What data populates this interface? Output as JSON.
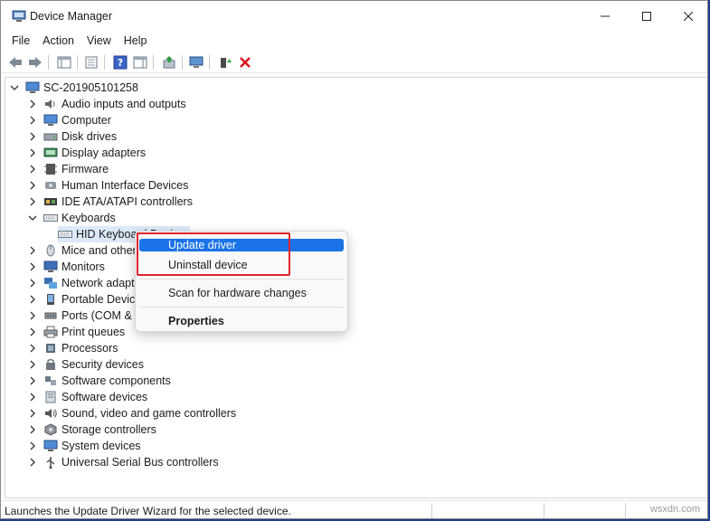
{
  "window": {
    "title": "Device Manager"
  },
  "menu": [
    "File",
    "Action",
    "View",
    "Help"
  ],
  "tree": {
    "root": "SC-201905101258",
    "categories": [
      {
        "label": "Audio inputs and outputs",
        "icon": "speaker-icon"
      },
      {
        "label": "Computer",
        "icon": "computer-icon"
      },
      {
        "label": "Disk drives",
        "icon": "disk-icon"
      },
      {
        "label": "Display adapters",
        "icon": "display-icon"
      },
      {
        "label": "Firmware",
        "icon": "firmware-icon"
      },
      {
        "label": "Human Interface Devices",
        "icon": "hid-icon"
      },
      {
        "label": "IDE ATA/ATAPI controllers",
        "icon": "ide-icon"
      },
      {
        "label": "Keyboards",
        "icon": "keyboard-icon",
        "expanded": true
      },
      {
        "label": "Mice and other",
        "icon": "mouse-icon"
      },
      {
        "label": "Monitors",
        "icon": "monitor-icon"
      },
      {
        "label": "Network adapte",
        "icon": "network-icon"
      },
      {
        "label": "Portable Device",
        "icon": "portable-icon"
      },
      {
        "label": "Ports (COM & L",
        "icon": "port-icon"
      },
      {
        "label": "Print queues",
        "icon": "printer-icon"
      },
      {
        "label": "Processors",
        "icon": "processor-icon"
      },
      {
        "label": "Security devices",
        "icon": "security-icon"
      },
      {
        "label": "Software components",
        "icon": "software-component-icon"
      },
      {
        "label": "Software devices",
        "icon": "software-device-icon"
      },
      {
        "label": "Sound, video and game controllers",
        "icon": "sound-icon"
      },
      {
        "label": "Storage controllers",
        "icon": "storage-icon"
      },
      {
        "label": "System devices",
        "icon": "system-icon"
      },
      {
        "label": "Universal Serial Bus controllers",
        "icon": "usb-icon"
      }
    ],
    "keyboard_child": "HID Keyboard Device"
  },
  "context_menu": {
    "update": "Update driver",
    "uninstall": "Uninstall device",
    "scan": "Scan for hardware changes",
    "properties": "Properties"
  },
  "status": {
    "text": "Launches the Update Driver Wizard for the selected device."
  },
  "watermark": "wsxdn.com",
  "colors": {
    "highlight": "#1a73e8",
    "annotation_box": "#e0242c",
    "selection": "#dbe9f8"
  }
}
